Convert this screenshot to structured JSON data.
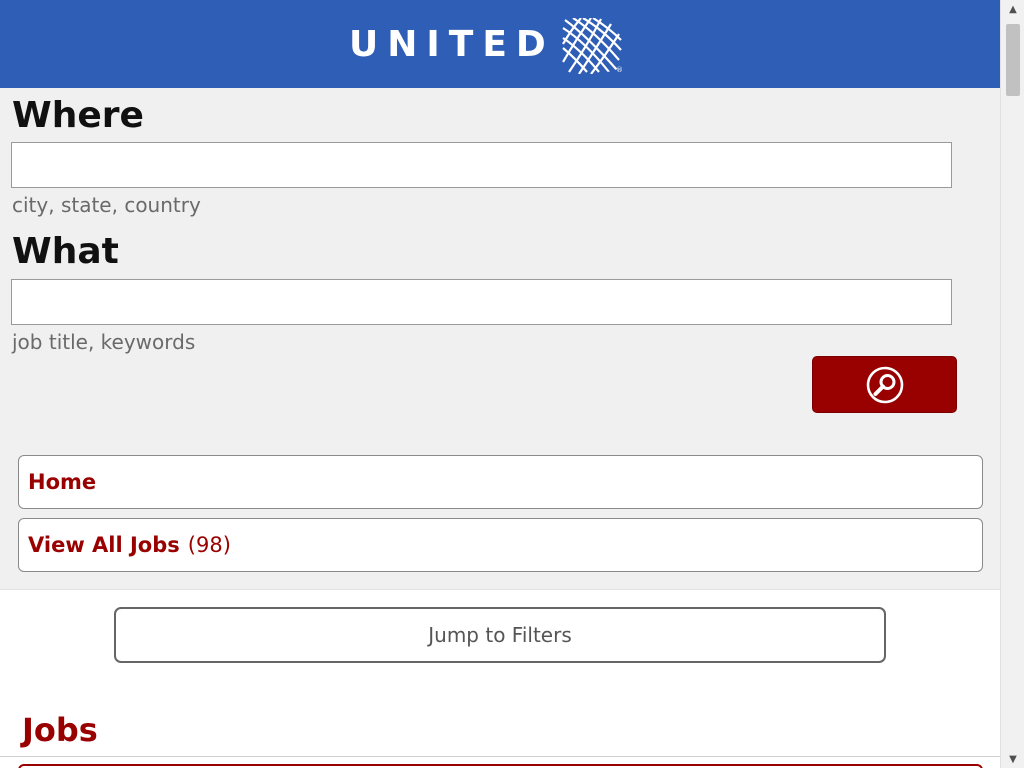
{
  "header": {
    "logo_text": "UNITED",
    "brand_color": "#2f5eb7",
    "logo_icon": "globe-icon"
  },
  "search": {
    "where_label": "Where",
    "where_value": "",
    "where_hint": "city, state, country",
    "what_label": "What",
    "what_value": "",
    "what_hint": "job title, keywords",
    "search_icon": "magnifier-icon",
    "accent_color": "#990000"
  },
  "nav": {
    "home_label": "Home",
    "view_all_label": "View All Jobs",
    "view_all_count": "(98)"
  },
  "jump_to_filters_label": "Jump to Filters",
  "jobs_heading": "Jobs",
  "scrollbar": {
    "up_icon": "scroll-up-arrow-icon",
    "down_icon": "scroll-down-arrow-icon"
  }
}
